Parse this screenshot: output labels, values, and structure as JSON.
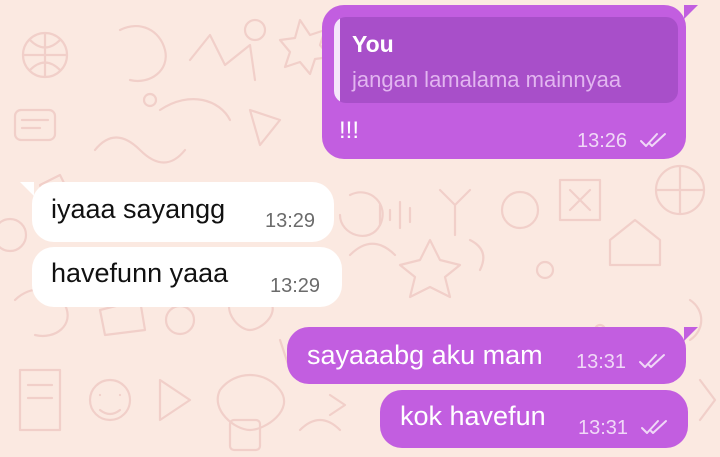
{
  "messages": [
    {
      "direction": "outgoing",
      "quoted": {
        "author": "You",
        "text": "jangan lamalama mainnyaa"
      },
      "text": "!!!",
      "time": "13:26",
      "status": "read"
    },
    {
      "direction": "incoming",
      "text": "iyaaa sayangg",
      "time": "13:29"
    },
    {
      "direction": "incoming",
      "text": "havefunn yaaa",
      "time": "13:29"
    },
    {
      "direction": "outgoing",
      "text": "sayaaabg aku mam",
      "time": "13:31",
      "status": "read"
    },
    {
      "direction": "outgoing",
      "text": "kok havefun",
      "time": "13:31",
      "status": "read"
    }
  ],
  "colors": {
    "outgoing_bubble": "#c25ee0",
    "incoming_bubble": "#ffffff",
    "quote_background": "#a84fc9",
    "wallpaper": "#fbe9e1",
    "wallpaper_doodles": "#f1cfc9"
  },
  "icons": {
    "read_receipt": "double-check-icon"
  }
}
